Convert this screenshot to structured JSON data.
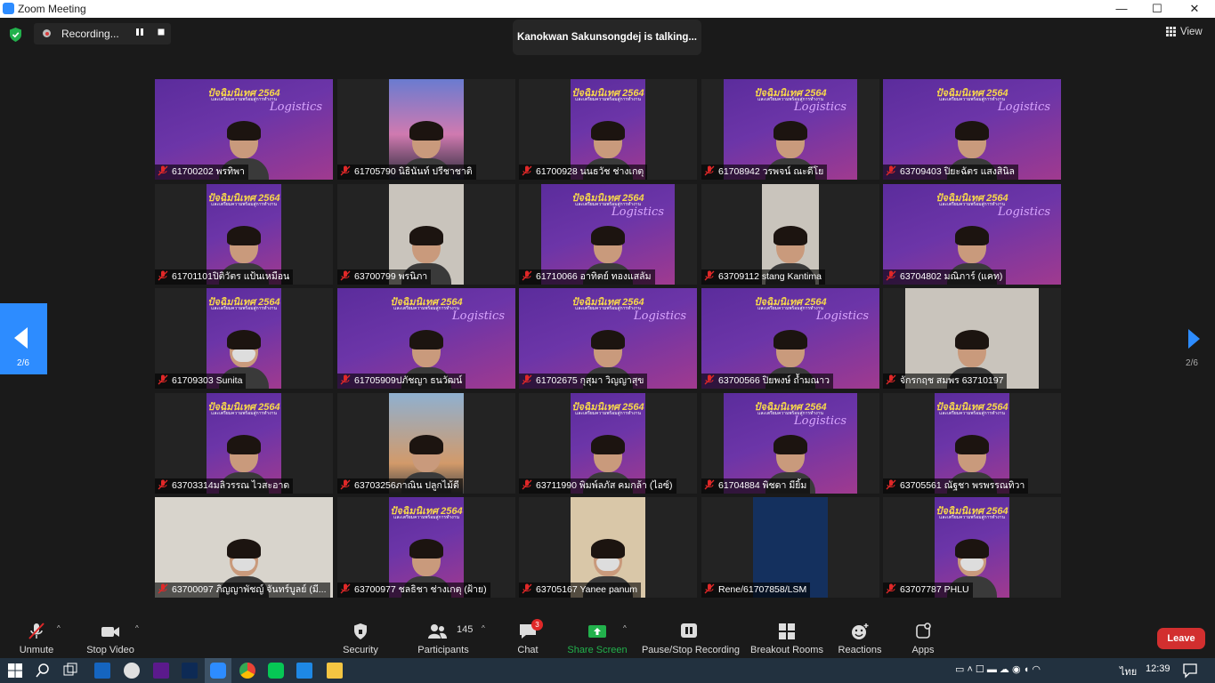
{
  "window": {
    "title": "Zoom Meeting",
    "minimize": "—",
    "maximize": "☐",
    "close": "✕"
  },
  "topbar": {
    "recording_label": "Recording...",
    "talking": "Kanokwan Sakunsongdej is talking...",
    "view_label": "View"
  },
  "pagination": {
    "left": "2/6",
    "right": "2/6"
  },
  "banner": {
    "headline": "ปัจฉิมนิเทศ 2564",
    "subline": "และเตรียมความพร้อมสู่การทำงาน",
    "script": "Logistics"
  },
  "participants": [
    "61700202 พรทิพา",
    "61705790 นิธินันท์ ปรีชาชาติ",
    "61700928  นนธวัช ช่างเกตุ",
    "61708942 วรพจน์ ณะดีโย",
    "63709403 ปิยะฉัตร แสงสินิล",
    "61701101ปิติวัตร แป้นเหมือน",
    "63700799 พรนิภา",
    "61710066 อาทิตย์ ทองแสลัม",
    "63709112 stang Kantima",
    "63704802  มณิภาร์ (แคท)",
    "61709303 Sunita",
    "61705909ปภัชญา ธนวัฒน์",
    "61702675 กุสุมา วิญญาสุข",
    "63700566 ปิยพงษ์ ถ้ำมณาว",
    "จักรกฤช สมพร 63710197",
    "63703314มลิวรรณ ไวสะอาด",
    "63703256ภาณิน ปลูกไม้ดี",
    "63711990 พิมพ์ลภัส คมกล้า (ไอซ์)",
    "61704884 พิชดา มียิ้ม",
    "63705561 ณัฐชา พรพรรณทิวา",
    "63700097 ภิญญาพัชญ์ จันทร์บูลย์ (มี...",
    "63700977 ชลธิชา  ช่างเกตุ (ฝ้าย)",
    "63705167 Yanee panum",
    "Rene/61707858/LSM",
    "63707787 PHLU"
  ],
  "toolbar": {
    "unmute": "Unmute",
    "stop_video": "Stop Video",
    "security": "Security",
    "participants": "Participants",
    "participants_count": "145",
    "chat": "Chat",
    "chat_badge": "3",
    "share_screen": "Share Screen",
    "pause_recording": "Pause/Stop Recording",
    "breakout_rooms": "Breakout Rooms",
    "reactions": "Reactions",
    "apps": "Apps",
    "leave": "Leave"
  },
  "taskbar": {
    "language": "ไทย",
    "time": "12:39"
  },
  "colors": {
    "accent": "#2d8cff",
    "leave": "#d22f2f",
    "share": "#22b14c",
    "banner": "#6c35a8",
    "muted": "#e02828"
  }
}
